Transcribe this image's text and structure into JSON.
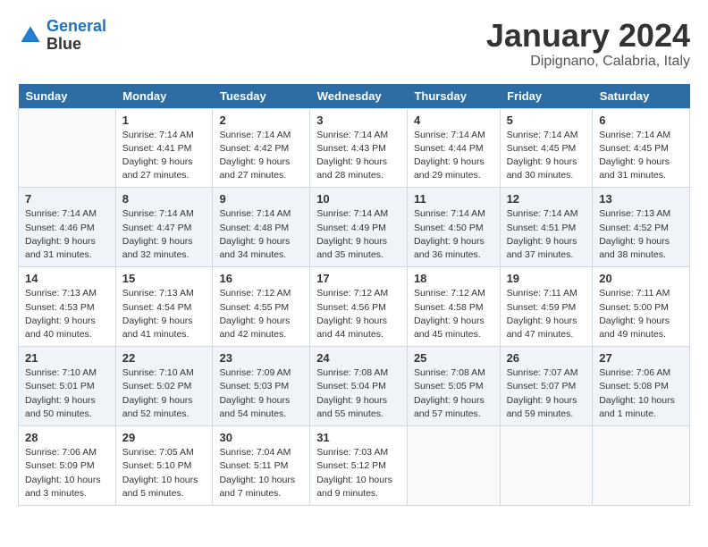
{
  "logo": {
    "line1": "General",
    "line2": "Blue"
  },
  "title": "January 2024",
  "subtitle": "Dipignano, Calabria, Italy",
  "days_of_week": [
    "Sunday",
    "Monday",
    "Tuesday",
    "Wednesday",
    "Thursday",
    "Friday",
    "Saturday"
  ],
  "weeks": [
    [
      {
        "day": "",
        "info": ""
      },
      {
        "day": "1",
        "info": "Sunrise: 7:14 AM\nSunset: 4:41 PM\nDaylight: 9 hours\nand 27 minutes."
      },
      {
        "day": "2",
        "info": "Sunrise: 7:14 AM\nSunset: 4:42 PM\nDaylight: 9 hours\nand 27 minutes."
      },
      {
        "day": "3",
        "info": "Sunrise: 7:14 AM\nSunset: 4:43 PM\nDaylight: 9 hours\nand 28 minutes."
      },
      {
        "day": "4",
        "info": "Sunrise: 7:14 AM\nSunset: 4:44 PM\nDaylight: 9 hours\nand 29 minutes."
      },
      {
        "day": "5",
        "info": "Sunrise: 7:14 AM\nSunset: 4:45 PM\nDaylight: 9 hours\nand 30 minutes."
      },
      {
        "day": "6",
        "info": "Sunrise: 7:14 AM\nSunset: 4:45 PM\nDaylight: 9 hours\nand 31 minutes."
      }
    ],
    [
      {
        "day": "7",
        "info": ""
      },
      {
        "day": "8",
        "info": "Sunrise: 7:14 AM\nSunset: 4:47 PM\nDaylight: 9 hours\nand 32 minutes."
      },
      {
        "day": "9",
        "info": "Sunrise: 7:14 AM\nSunset: 4:48 PM\nDaylight: 9 hours\nand 34 minutes."
      },
      {
        "day": "10",
        "info": "Sunrise: 7:14 AM\nSunset: 4:49 PM\nDaylight: 9 hours\nand 35 minutes."
      },
      {
        "day": "11",
        "info": "Sunrise: 7:14 AM\nSunset: 4:50 PM\nDaylight: 9 hours\nand 36 minutes."
      },
      {
        "day": "12",
        "info": "Sunrise: 7:14 AM\nSunset: 4:51 PM\nDaylight: 9 hours\nand 37 minutes."
      },
      {
        "day": "13",
        "info": "Sunrise: 7:13 AM\nSunset: 4:52 PM\nDaylight: 9 hours\nand 38 minutes."
      }
    ],
    [
      {
        "day": "14",
        "info": ""
      },
      {
        "day": "15",
        "info": "Sunrise: 7:13 AM\nSunset: 4:54 PM\nDaylight: 9 hours\nand 41 minutes."
      },
      {
        "day": "16",
        "info": "Sunrise: 7:12 AM\nSunset: 4:55 PM\nDaylight: 9 hours\nand 42 minutes."
      },
      {
        "day": "17",
        "info": "Sunrise: 7:12 AM\nSunset: 4:56 PM\nDaylight: 9 hours\nand 44 minutes."
      },
      {
        "day": "18",
        "info": "Sunrise: 7:12 AM\nSunset: 4:58 PM\nDaylight: 9 hours\nand 45 minutes."
      },
      {
        "day": "19",
        "info": "Sunrise: 7:11 AM\nSunset: 4:59 PM\nDaylight: 9 hours\nand 47 minutes."
      },
      {
        "day": "20",
        "info": "Sunrise: 7:11 AM\nSunset: 5:00 PM\nDaylight: 9 hours\nand 49 minutes."
      }
    ],
    [
      {
        "day": "21",
        "info": ""
      },
      {
        "day": "22",
        "info": "Sunrise: 7:10 AM\nSunset: 5:02 PM\nDaylight: 9 hours\nand 52 minutes."
      },
      {
        "day": "23",
        "info": "Sunrise: 7:09 AM\nSunset: 5:03 PM\nDaylight: 9 hours\nand 54 minutes."
      },
      {
        "day": "24",
        "info": "Sunrise: 7:08 AM\nSunset: 5:04 PM\nDaylight: 9 hours\nand 55 minutes."
      },
      {
        "day": "25",
        "info": "Sunrise: 7:08 AM\nSunset: 5:05 PM\nDaylight: 9 hours\nand 57 minutes."
      },
      {
        "day": "26",
        "info": "Sunrise: 7:07 AM\nSunset: 5:07 PM\nDaylight: 9 hours\nand 59 minutes."
      },
      {
        "day": "27",
        "info": "Sunrise: 7:06 AM\nSunset: 5:08 PM\nDaylight: 10 hours\nand 1 minute."
      }
    ],
    [
      {
        "day": "28",
        "info": ""
      },
      {
        "day": "29",
        "info": "Sunrise: 7:05 AM\nSunset: 5:10 PM\nDaylight: 10 hours\nand 5 minutes."
      },
      {
        "day": "30",
        "info": "Sunrise: 7:04 AM\nSunset: 5:11 PM\nDaylight: 10 hours\nand 7 minutes."
      },
      {
        "day": "31",
        "info": "Sunrise: 7:03 AM\nSunset: 5:12 PM\nDaylight: 10 hours\nand 9 minutes."
      },
      {
        "day": "",
        "info": ""
      },
      {
        "day": "",
        "info": ""
      },
      {
        "day": "",
        "info": ""
      }
    ]
  ],
  "week1_sunday": {
    "day": "",
    "info": ""
  },
  "week2_sunday": {
    "day": "7",
    "info": "Sunrise: 7:14 AM\nSunset: 4:46 PM\nDaylight: 9 hours\nand 31 minutes."
  },
  "week3_sunday": {
    "day": "14",
    "info": "Sunrise: 7:13 AM\nSunset: 4:53 PM\nDaylight: 9 hours\nand 40 minutes."
  },
  "week4_sunday": {
    "day": "21",
    "info": "Sunrise: 7:10 AM\nSunset: 5:01 PM\nDaylight: 9 hours\nand 50 minutes."
  },
  "week5_sunday": {
    "day": "28",
    "info": "Sunrise: 7:06 AM\nSunset: 5:09 PM\nDaylight: 10 hours\nand 3 minutes."
  }
}
